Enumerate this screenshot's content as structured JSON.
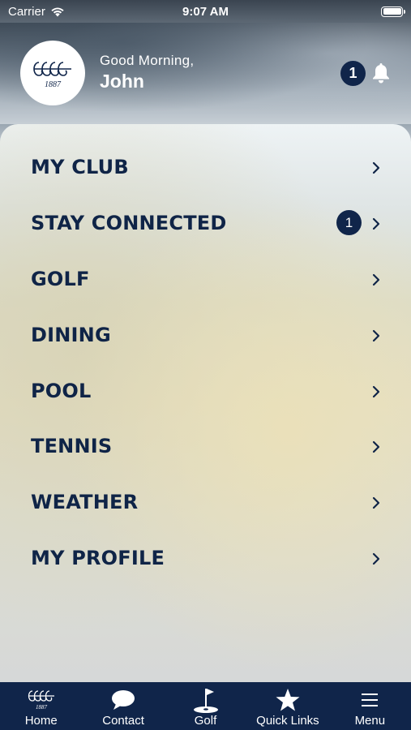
{
  "status_bar": {
    "carrier": "Carrier",
    "time": "9:07 AM"
  },
  "header": {
    "logo_text": "1887",
    "greeting": "Good Morning,",
    "name": "John",
    "notification_count": "1"
  },
  "menu": {
    "items": [
      {
        "label": "MY CLUB",
        "badge": ""
      },
      {
        "label": "STAY CONNECTED",
        "badge": "1"
      },
      {
        "label": "GOLF",
        "badge": ""
      },
      {
        "label": "DINING",
        "badge": ""
      },
      {
        "label": "POOL",
        "badge": ""
      },
      {
        "label": "TENNIS",
        "badge": ""
      },
      {
        "label": "WEATHER",
        "badge": ""
      },
      {
        "label": "MY PROFILE",
        "badge": ""
      }
    ]
  },
  "tab_bar": {
    "items": [
      {
        "label": "Home",
        "icon": "club-logo-icon"
      },
      {
        "label": "Contact",
        "icon": "chat-bubble-icon"
      },
      {
        "label": "Golf",
        "icon": "golf-flag-icon"
      },
      {
        "label": "Quick Links",
        "icon": "star-icon"
      },
      {
        "label": "Menu",
        "icon": "hamburger-menu-icon"
      }
    ]
  },
  "colors": {
    "navy": "#10254a",
    "text_navy": "#0f2447",
    "white": "#ffffff"
  }
}
